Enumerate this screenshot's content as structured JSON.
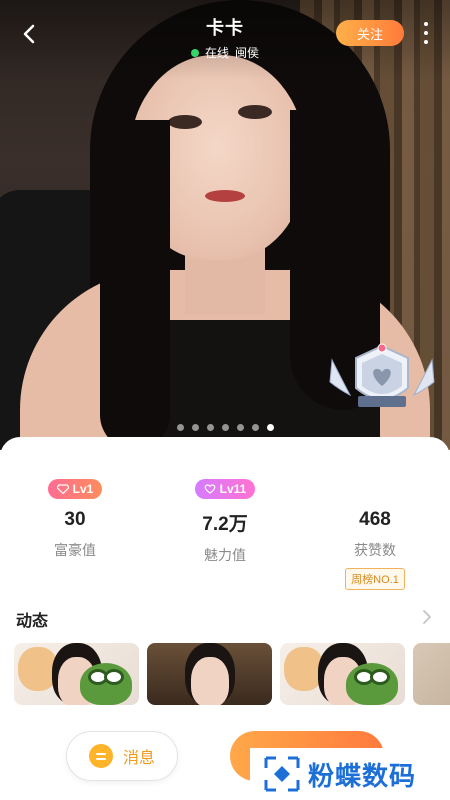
{
  "header": {
    "name": "卡卡",
    "status": "在线",
    "location": "闽侯",
    "follow_label": "关注"
  },
  "gallery": {
    "total": 7,
    "active_index": 6
  },
  "stats": [
    {
      "level": "Lv1",
      "value": "30",
      "label": "富豪值",
      "color": "#ff7186",
      "icon": "diamond-icon"
    },
    {
      "level": "Lv11",
      "value": "7.2万",
      "label": "魅力值",
      "color": "#e27bff",
      "icon": "heart-icon"
    },
    {
      "value": "468",
      "label": "获赞数",
      "rank": "周榜NO.1"
    }
  ],
  "moments": {
    "title": "动态"
  },
  "actions": {
    "message_label": "消息"
  },
  "watermark": {
    "text": "粉蝶数码"
  },
  "colors": {
    "accent": "#ff8a3d",
    "online": "#35d46a",
    "rank": "#d98a1f"
  }
}
